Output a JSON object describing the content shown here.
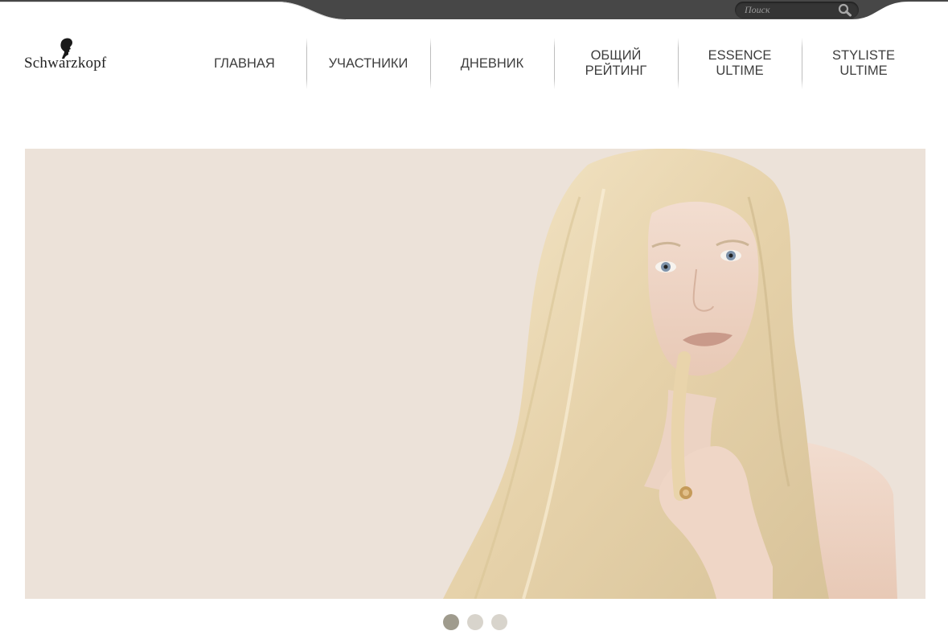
{
  "header": {
    "brand": "Schwarzkopf",
    "search": {
      "placeholder": "Поиск"
    }
  },
  "nav": {
    "items": [
      {
        "label": "ГЛАВНАЯ"
      },
      {
        "label": "УЧАСТНИКИ"
      },
      {
        "label": "ДНЕВНИК"
      },
      {
        "label": "ОБЩИЙ\nРЕЙТИНГ"
      },
      {
        "label": "ESSENCE\nULTIME"
      },
      {
        "label": "STYLISTE\nULTIME"
      }
    ]
  },
  "carousel": {
    "slide_count": 3,
    "active_index": 0
  },
  "colors": {
    "topbar": "#474747",
    "hero_bg": "#ece2d9",
    "dot_active": "#9f9b8d",
    "dot_inactive": "#d8d4cc"
  }
}
